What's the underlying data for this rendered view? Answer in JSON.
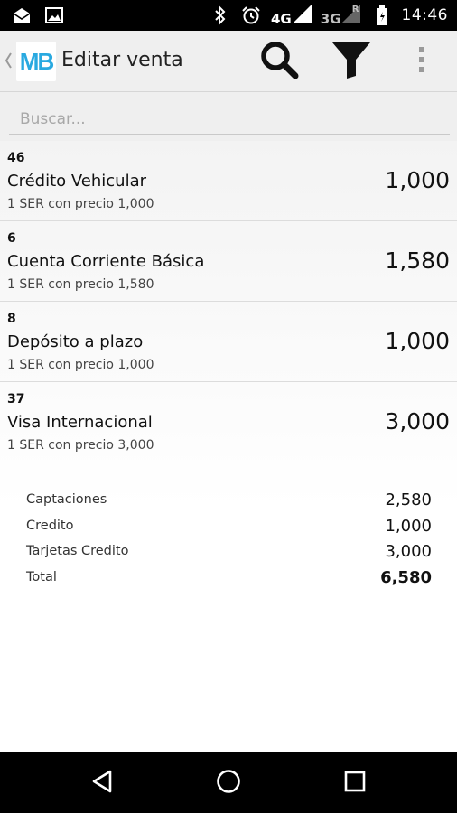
{
  "status_bar": {
    "network_type": "4G",
    "secondary_network": "3G",
    "roaming_indicator": "R",
    "time": "14:46",
    "icons": [
      "mail-icon",
      "image-icon",
      "bluetooth-icon",
      "alarm-icon",
      "signal-icon",
      "signal-roaming-icon",
      "battery-icon"
    ]
  },
  "app_bar": {
    "logo_text": "MB",
    "title": "Editar venta",
    "actions": [
      "search-icon",
      "filter-icon",
      "overflow-menu-icon"
    ]
  },
  "search": {
    "placeholder": "Buscar..."
  },
  "items": [
    {
      "code": "46",
      "name": "Crédito Vehicular",
      "detail": "1 SER con precio 1,000",
      "amount": "1,000"
    },
    {
      "code": "6",
      "name": "Cuenta Corriente Básica",
      "detail": "1 SER con precio 1,580",
      "amount": "1,580"
    },
    {
      "code": "8",
      "name": "Depósito a plazo",
      "detail": "1 SER con precio 1,000",
      "amount": "1,000"
    },
    {
      "code": "37",
      "name": "Visa Internacional",
      "detail": "1 SER con precio 3,000",
      "amount": "3,000"
    }
  ],
  "totals": [
    {
      "label": "Captaciones",
      "value": "2,580"
    },
    {
      "label": "Credito",
      "value": "1,000"
    },
    {
      "label": "Tarjetas Credito",
      "value": "3,000"
    },
    {
      "label": "Total",
      "value": "6,580"
    }
  ],
  "nav_bar": {
    "buttons": [
      "back-icon",
      "home-icon",
      "recents-icon"
    ]
  },
  "colors": {
    "brand": "#29a9e0",
    "app_bar_bg": "#efefef",
    "status_bar_bg": "#000000"
  }
}
